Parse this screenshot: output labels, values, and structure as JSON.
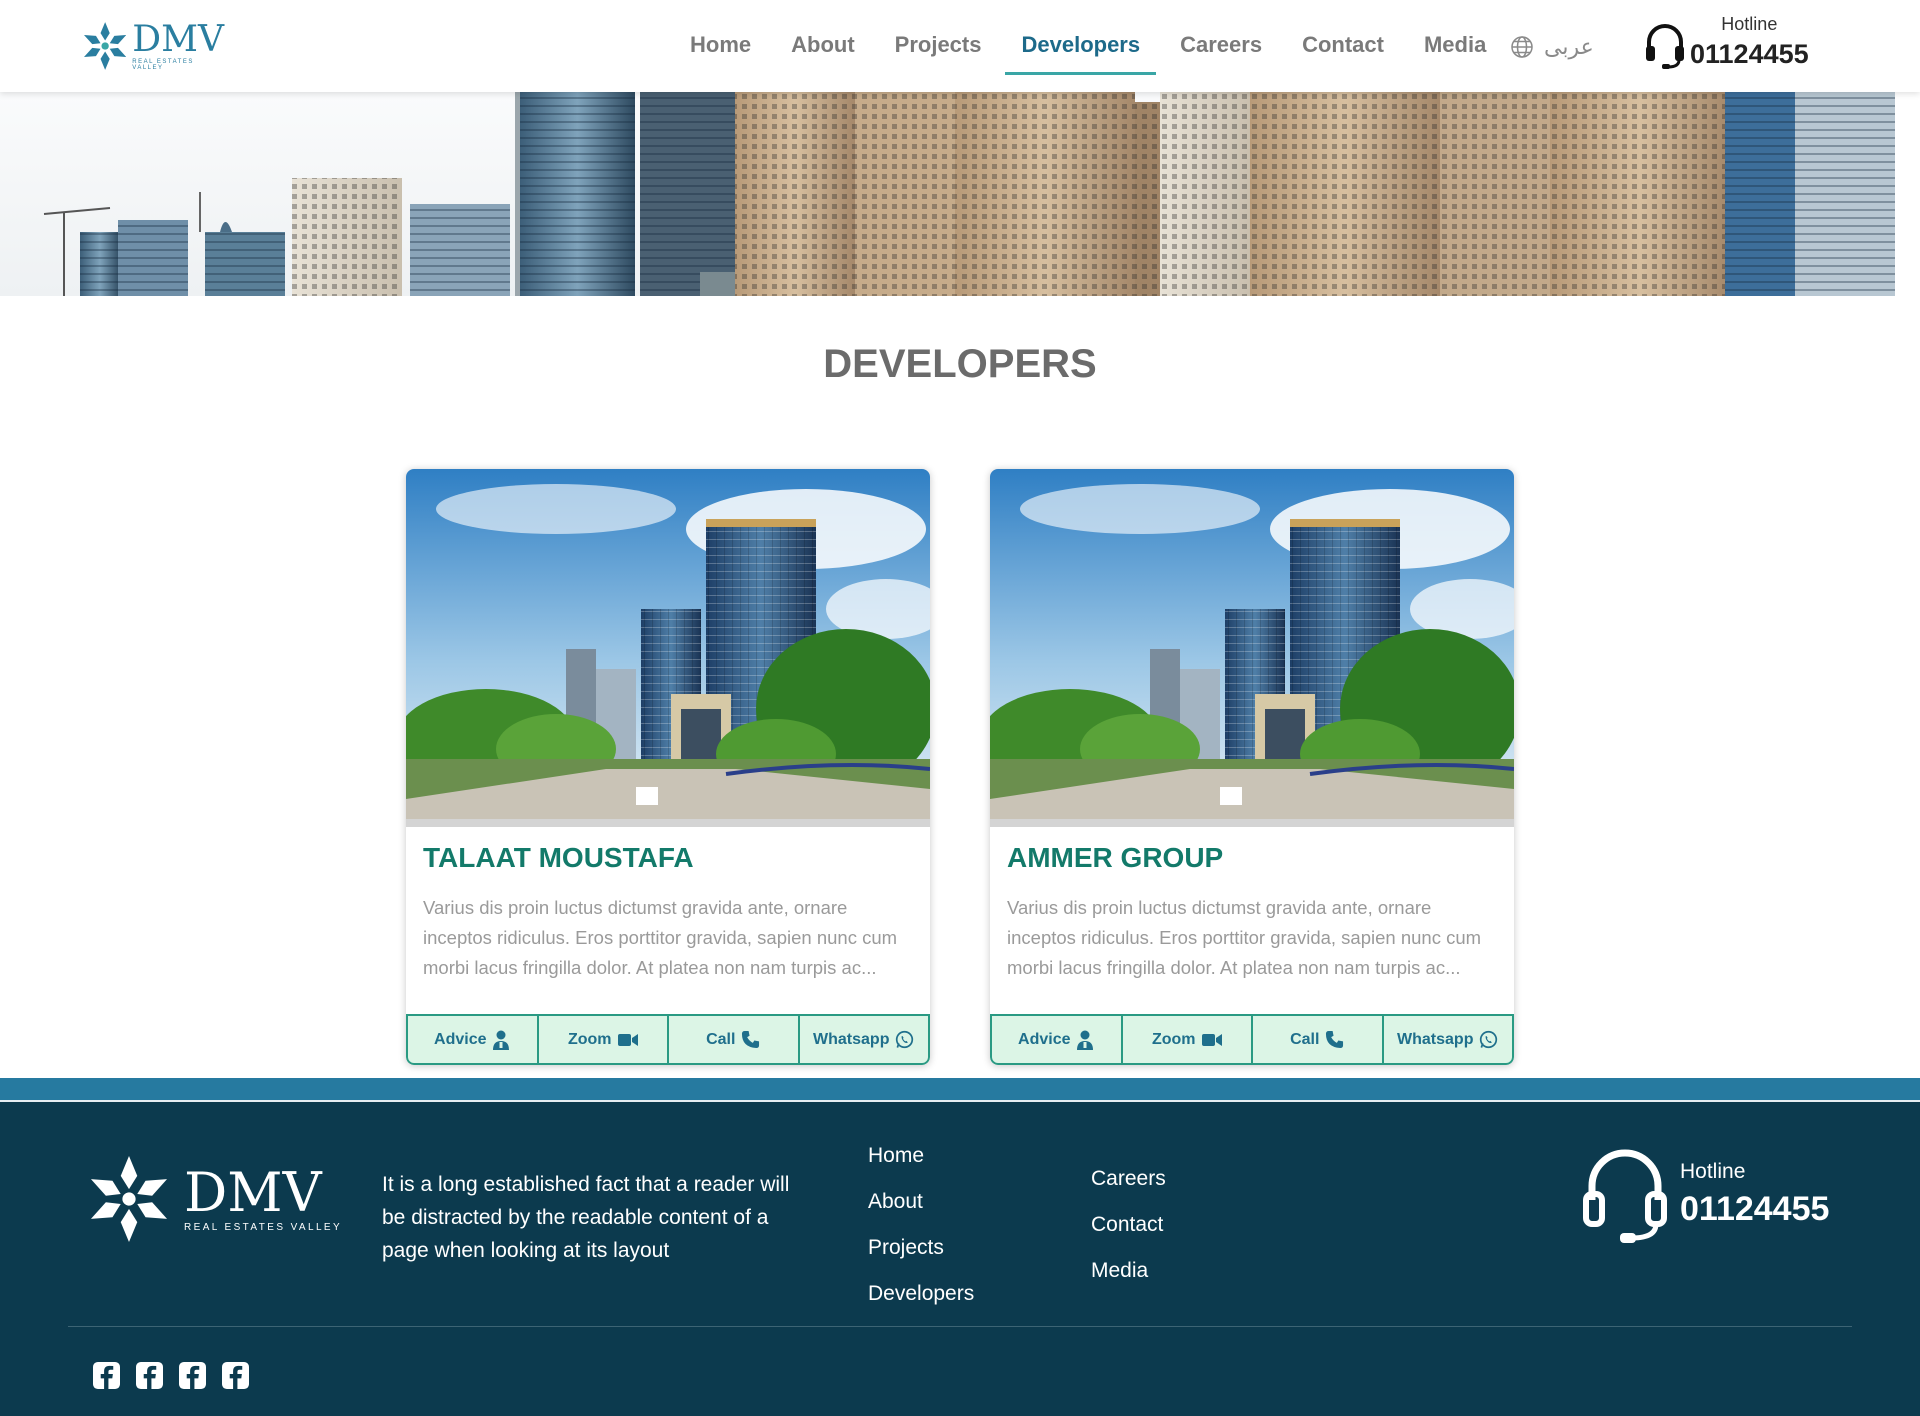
{
  "header": {
    "logo": {
      "brand": "DMV",
      "tagline": "REAL ESTATES VALLEY"
    },
    "nav": [
      {
        "label": "Home"
      },
      {
        "label": "About"
      },
      {
        "label": "Projects"
      },
      {
        "label": "Developers",
        "active": true
      },
      {
        "label": "Careers"
      },
      {
        "label": "Contact"
      },
      {
        "label": "Media"
      }
    ],
    "language": {
      "label": "عربى",
      "icon": "globe-icon"
    },
    "hotline": {
      "label": "Hotline",
      "number": "01124455",
      "icon": "headset-icon"
    }
  },
  "page": {
    "title": "DEVELOPERS"
  },
  "developers": [
    {
      "name": "TALAAT MOUSTAFA",
      "description": "Varius dis proin luctus dictumst gravida ante, ornare inceptos ridiculus. Eros porttitor gravida, sapien nunc cum morbi lacus fringilla dolor. At platea non nam turpis ac...",
      "actions": {
        "advice": "Advice",
        "zoom": "Zoom",
        "call": "Call",
        "whatsapp": "Whatsapp"
      }
    },
    {
      "name": "AMMER GROUP",
      "description": "Varius dis proin luctus dictumst gravida ante, ornare inceptos ridiculus. Eros porttitor gravida, sapien nunc cum morbi lacus fringilla dolor. At platea non nam turpis ac...",
      "actions": {
        "advice": "Advice",
        "zoom": "Zoom",
        "call": "Call",
        "whatsapp": "Whatsapp"
      }
    }
  ],
  "footer": {
    "logo": {
      "brand": "DMV",
      "tagline": "REAL ESTATES VALLEY"
    },
    "description": "It is a long established fact that a reader will be distracted by the readable content of a page when looking at its layout",
    "links_col1": [
      "Home",
      "About",
      "Projects",
      "Developers"
    ],
    "links_col2": [
      "Careers",
      "Contact",
      "Media"
    ],
    "hotline": {
      "label": "Hotline",
      "number": "01124455"
    },
    "social": [
      "facebook-icon",
      "facebook-icon",
      "facebook-icon",
      "facebook-icon"
    ]
  },
  "colors": {
    "brand": "#2a7ea0",
    "accent_green": "#137a6a",
    "footer_bg": "#0c3a4e",
    "footer_band": "#267aa0",
    "action_bg": "#dcf5e6"
  }
}
